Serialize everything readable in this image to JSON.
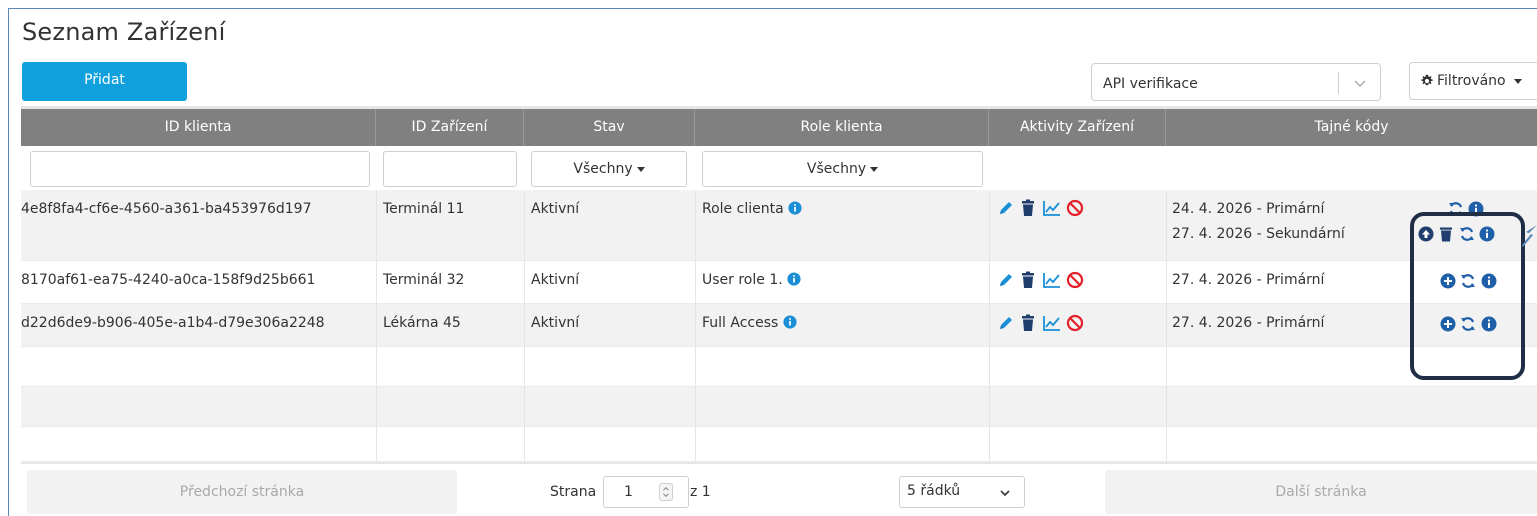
{
  "page": {
    "title": "Seznam Zařízení"
  },
  "toolbar": {
    "add_label": "Přidat",
    "api_select_value": "API verifikace",
    "filter_label": "Filtrováno"
  },
  "table": {
    "columns": [
      "ID klienta",
      "ID Zařízení",
      "Stav",
      "Role klienta",
      "Aktivity Zařízení",
      "Tajné kódy"
    ],
    "filters": {
      "stav": "Všechny",
      "role": "Všechny"
    },
    "rows": [
      {
        "client_id": "4e8f8fa4-cf6e-4560-a361-ba453976d197",
        "device_id": "Terminál 11",
        "status": "Aktivní",
        "role": "Role clienta",
        "secrets": [
          "24. 4. 2026 - Primární",
          "27. 4. 2026 - Sekundární"
        ]
      },
      {
        "client_id": "8170af61-ea75-4240-a0ca-158f9d25b661",
        "device_id": "Terminál 32",
        "status": "Aktivní",
        "role": "User role 1.",
        "secrets": [
          "27. 4. 2026 - Primární"
        ]
      },
      {
        "client_id": "d22d6de9-b906-405e-a1b4-d79e306a2248",
        "device_id": "Lékárna 45",
        "status": "Aktivní",
        "role": "Full Access",
        "secrets": [
          "27. 4. 2026 - Primární"
        ]
      }
    ]
  },
  "pagination": {
    "prev_label": "Předchozí stránka",
    "page_label": "Strana",
    "page_value": "1",
    "of_label": "z 1",
    "rows_option": "5 řádků",
    "next_label": "Další stránka"
  },
  "colors": {
    "accent": "#0fa0dd",
    "icon_blue": "#1a8fd6",
    "icon_dark": "#1f3e6e",
    "ban_red": "#e3202a",
    "header_gray": "#808080"
  },
  "icons": [
    "pencil-icon",
    "trash-icon",
    "chart-icon",
    "ban-icon",
    "info-icon",
    "refresh-icon",
    "upload-icon",
    "plus-circle-icon",
    "gear-icon"
  ]
}
